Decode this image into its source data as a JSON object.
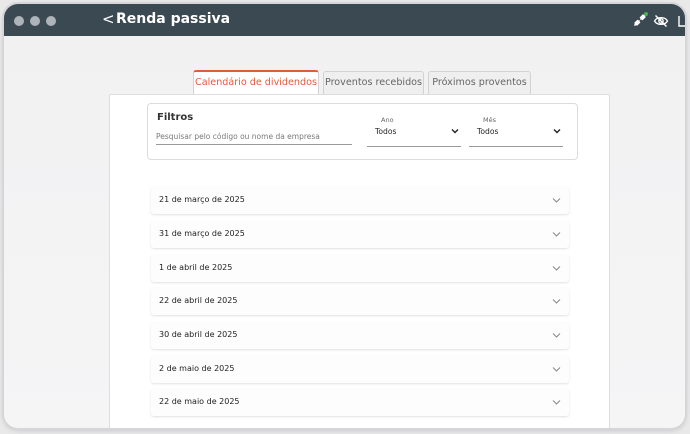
{
  "app": {
    "title": "Renda passiva",
    "back_glyph": "<",
    "icons": [
      "sync-icon",
      "eye-off-icon"
    ],
    "status_dot_color": "#4caf50"
  },
  "tabs": [
    {
      "label": "Calendário de dividendos",
      "active": true
    },
    {
      "label": "Proventos recebidos",
      "active": false
    },
    {
      "label": "Próximos proventos",
      "active": false
    }
  ],
  "filters": {
    "title": "Filtros",
    "search_placeholder": "Pesquisar pelo código ou nome da empresa",
    "ano": {
      "label": "Ano",
      "value": "Todos"
    },
    "mes": {
      "label": "Mês",
      "value": "Todos"
    }
  },
  "dates": [
    "21 de março de 2025",
    "31 de março de 2025",
    "1 de abril de 2025",
    "22 de abril de 2025",
    "30 de abril de 2025",
    "2 de maio de 2025",
    "22 de maio de 2025"
  ],
  "colors": {
    "accent": "#e15b3c",
    "titlebar": "#3b4953"
  }
}
